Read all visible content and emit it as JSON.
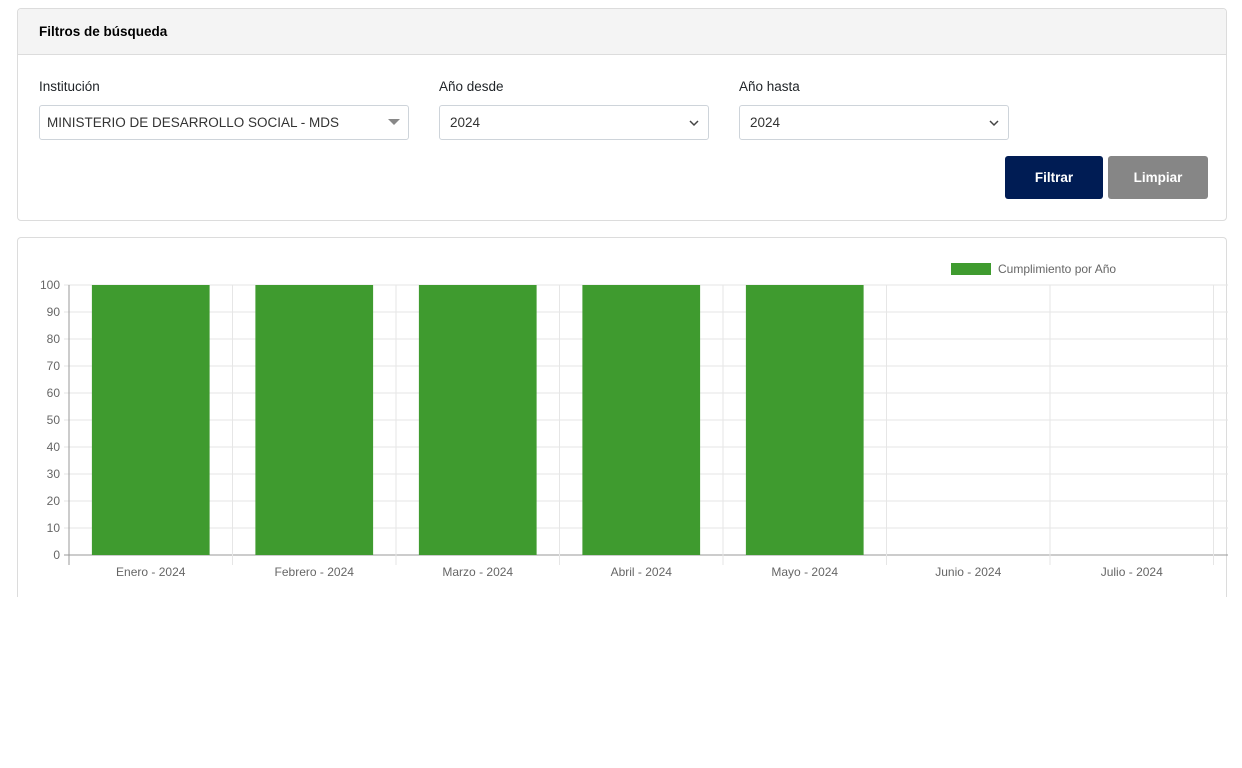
{
  "filters": {
    "title": "Filtros de búsqueda",
    "institution": {
      "label": "Institución",
      "value": "MINISTERIO DE DESARROLLO SOCIAL - MDS"
    },
    "year_from": {
      "label": "Año desde",
      "value": "2024"
    },
    "year_to": {
      "label": "Año hasta",
      "value": "2024"
    },
    "filter_button": "Filtrar",
    "clear_button": "Limpiar"
  },
  "colors": {
    "primary_button": "#001c54",
    "secondary_button": "#868686",
    "bar": "#3f9b2f"
  },
  "chart_data": {
    "type": "bar",
    "categories": [
      "Enero - 2024",
      "Febrero - 2024",
      "Marzo - 2024",
      "Abril - 2024",
      "Mayo - 2024",
      "Junio - 2024",
      "Julio - 2024"
    ],
    "series": [
      {
        "name": "Cumplimiento por Año",
        "values": [
          100,
          100,
          100,
          100,
          100,
          0,
          0
        ]
      }
    ],
    "ylim": [
      0,
      100
    ],
    "yticks": [
      0,
      10,
      20,
      30,
      40,
      50,
      60,
      70,
      80,
      90,
      100
    ],
    "grid": true,
    "legend": "top-right"
  }
}
